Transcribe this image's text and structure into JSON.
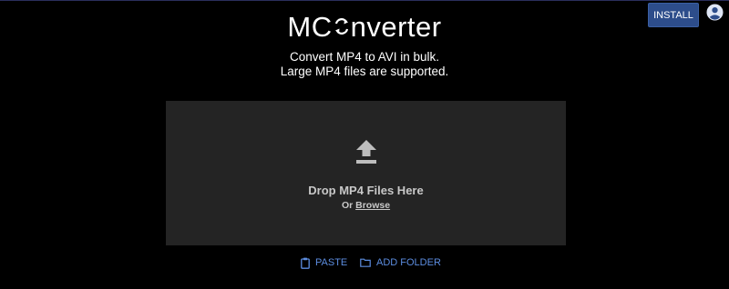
{
  "app": {
    "logo_before": "MC",
    "logo_icon": "convert-arrows-icon",
    "logo_after": "nverter"
  },
  "subtitle": {
    "line1": "Convert MP4 to AVI in bulk.",
    "line2": "Large MP4 files are supported."
  },
  "header": {
    "install_label": "INSTALL",
    "account_icon": "account-icon"
  },
  "dropzone": {
    "icon": "upload-icon",
    "title": "Drop MP4 Files Here",
    "or_text": "Or",
    "browse_label": "Browse"
  },
  "actions": {
    "paste_label": "PASTE",
    "paste_icon": "clipboard-icon",
    "add_folder_label": "ADD FOLDER",
    "add_folder_icon": "folder-icon"
  },
  "colors": {
    "background": "#000000",
    "install_button": "#2d4d8b",
    "dropzone": "#242424",
    "action_link": "#5c8de0"
  }
}
